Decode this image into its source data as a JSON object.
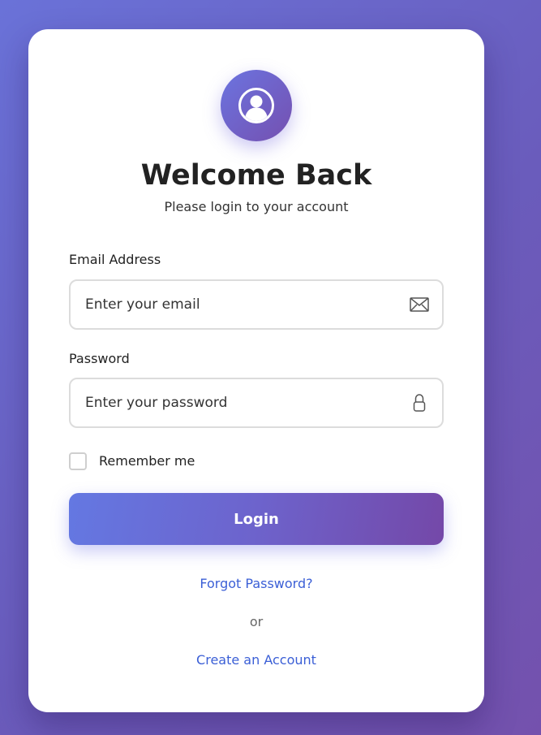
{
  "header": {
    "avatar_icon": "user-circle-icon",
    "title": "Welcome Back",
    "subtitle": "Please login to your account"
  },
  "form": {
    "email": {
      "label": "Email Address",
      "placeholder": "Enter your email",
      "value": "",
      "icon": "envelope-icon"
    },
    "password": {
      "label": "Password",
      "placeholder": "Enter your password",
      "value": "",
      "icon": "lock-icon"
    },
    "remember": {
      "label": "Remember me",
      "checked": false
    },
    "login_label": "Login"
  },
  "links": {
    "forgot_password": "Forgot Password?",
    "separator": "or",
    "create_account": "Create an Account"
  },
  "colors": {
    "background_start": "#6a72d8",
    "background_end": "#7451ad",
    "accent": "#6478e2",
    "link": "#3b5fd6"
  }
}
